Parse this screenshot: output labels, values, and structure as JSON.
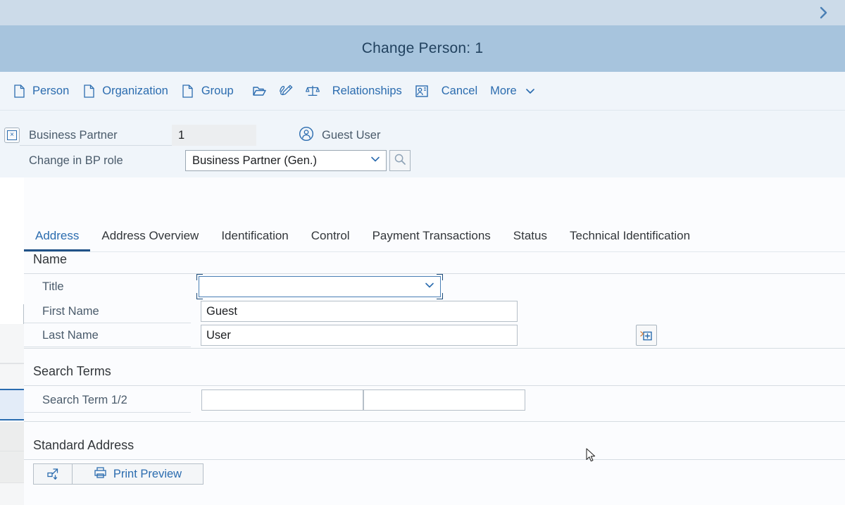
{
  "shell": {
    "expand_icon": "chevron-right-icon"
  },
  "header": {
    "title": "Change Person: 1"
  },
  "toolbar": {
    "items": [
      {
        "label": "",
        "icon": "key-icon",
        "clipped": true
      },
      {
        "label": "Person",
        "icon": "document-icon"
      },
      {
        "label": "Organization",
        "icon": "document-icon"
      },
      {
        "label": "Group",
        "icon": "document-icon"
      },
      {
        "label": "",
        "icon": "open-folder-icon"
      },
      {
        "label": "",
        "icon": "signature-icon"
      },
      {
        "label": "",
        "icon": "scales-icon"
      },
      {
        "label": "Relationships",
        "icon": ""
      },
      {
        "label": "",
        "icon": "person-card-icon"
      },
      {
        "label": "Cancel",
        "icon": ""
      },
      {
        "label": "More",
        "icon": "chevron-down-icon",
        "icon_trailing": true
      }
    ]
  },
  "object_header": {
    "close_glyph": "×",
    "business_partner": {
      "label": "Business Partner",
      "value": "1",
      "placeholder": ""
    },
    "guest": {
      "icon": "person-circle-icon",
      "name": "Guest User"
    },
    "bp_role": {
      "label": "Change in BP role",
      "value": "Business Partner (Gen.)",
      "options": [
        "Business Partner (Gen.)"
      ],
      "value_help_icon": "search-icon"
    }
  },
  "tabs": [
    {
      "label": "Address",
      "active": true
    },
    {
      "label": "Address Overview",
      "active": false
    },
    {
      "label": "Identification",
      "active": false
    },
    {
      "label": "Control",
      "active": false
    },
    {
      "label": "Payment Transactions",
      "active": false
    },
    {
      "label": "Status",
      "active": false
    },
    {
      "label": "Technical Identification",
      "active": false
    }
  ],
  "form": {
    "name_group": {
      "title": "Name",
      "title_field": {
        "label": "Title",
        "value": "",
        "placeholder": "",
        "focused": true
      },
      "first_name": {
        "label": "First Name",
        "value": "Guest",
        "placeholder": ""
      },
      "last_name": {
        "label": "Last Name",
        "value": "User",
        "placeholder": ""
      },
      "add_button_icon": "add-entry-icon"
    },
    "search_terms_group": {
      "title": "Search Terms",
      "search_term": {
        "label": "Search Term 1/2",
        "value_1": "",
        "value_2": "",
        "placeholder": ""
      }
    },
    "standard_address_group": {
      "title": "Standard Address",
      "expand_button_icon": "expand-arrow-icon",
      "print_preview": {
        "label": "Print Preview",
        "icon": "printer-icon"
      }
    }
  },
  "colors": {
    "shell_strip": "#ccdbe9",
    "title_bar": "#a7c4dd",
    "toolbar_bg": "#f0f5fa",
    "accent_blue": "#2b6caf",
    "tab_active_underline": "#205287",
    "content_bg": "#fbfcfe",
    "selected_row": "#e3ecf8"
  }
}
